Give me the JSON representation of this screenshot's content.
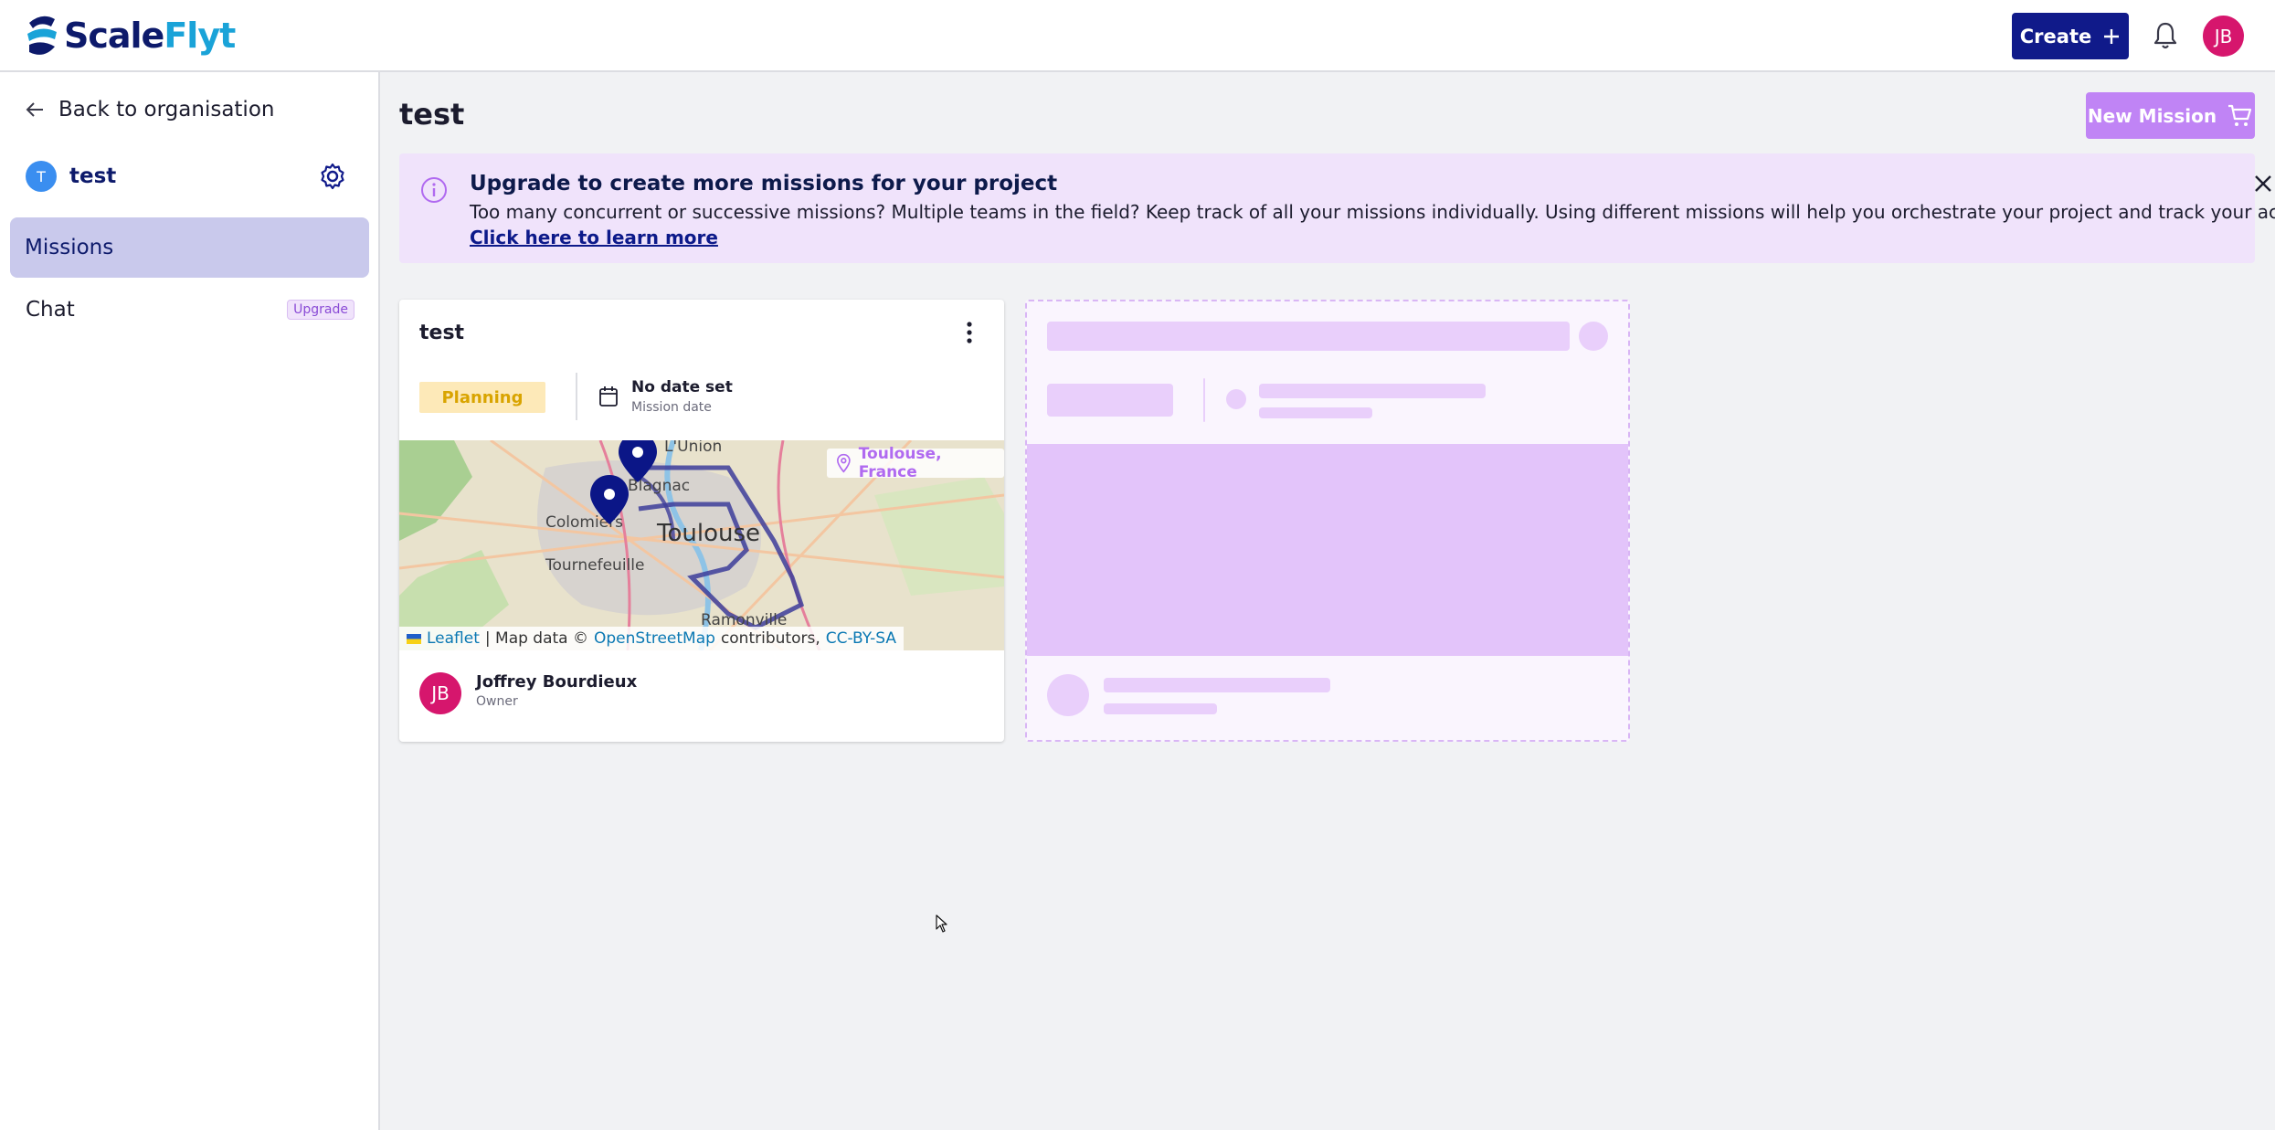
{
  "header": {
    "logo": {
      "part1": "Scale",
      "part2": "Flyt"
    },
    "create_label": "Create",
    "avatar_initials": "JB"
  },
  "sidebar": {
    "back_label": "Back to organisation",
    "project": {
      "initial": "T",
      "name": "test"
    },
    "items": [
      {
        "label": "Missions",
        "active": true
      },
      {
        "label": "Chat",
        "badge": "Upgrade"
      }
    ]
  },
  "main": {
    "title": "test",
    "new_mission_label": "New Mission",
    "banner": {
      "title": "Upgrade to create more missions for your project",
      "text": "Too many concurrent or successive missions? Multiple teams in the field? Keep track of all your missions individually. Using different missions will help you orchestrate your project and track your activities.",
      "link": "Click here to learn more"
    },
    "mission_card": {
      "title": "test",
      "status": "Planning",
      "date_value": "No date set",
      "date_label": "Mission date",
      "location": "Toulouse, France",
      "map_labels": {
        "toulouse": "Toulouse",
        "colomiers": "Colomiers",
        "tournefeuille": "Tournefeuille",
        "lunion": "L'Union",
        "blagnac": "Blagnac",
        "ramonville": "Ramonville"
      },
      "attribution": {
        "leaflet": "Leaflet",
        "sep": "| Map data ©",
        "osm": "OpenStreetMap",
        "contributors": "contributors,",
        "license": "CC-BY-SA"
      },
      "owner": {
        "initials": "JB",
        "name": "Joffrey Bourdieux",
        "role": "Owner"
      }
    }
  },
  "colors": {
    "brand_navy": "#101a8a",
    "accent_purple": "#c084f5",
    "avatar_pink": "#d6166d",
    "status_yellow": "#fde9b8"
  }
}
